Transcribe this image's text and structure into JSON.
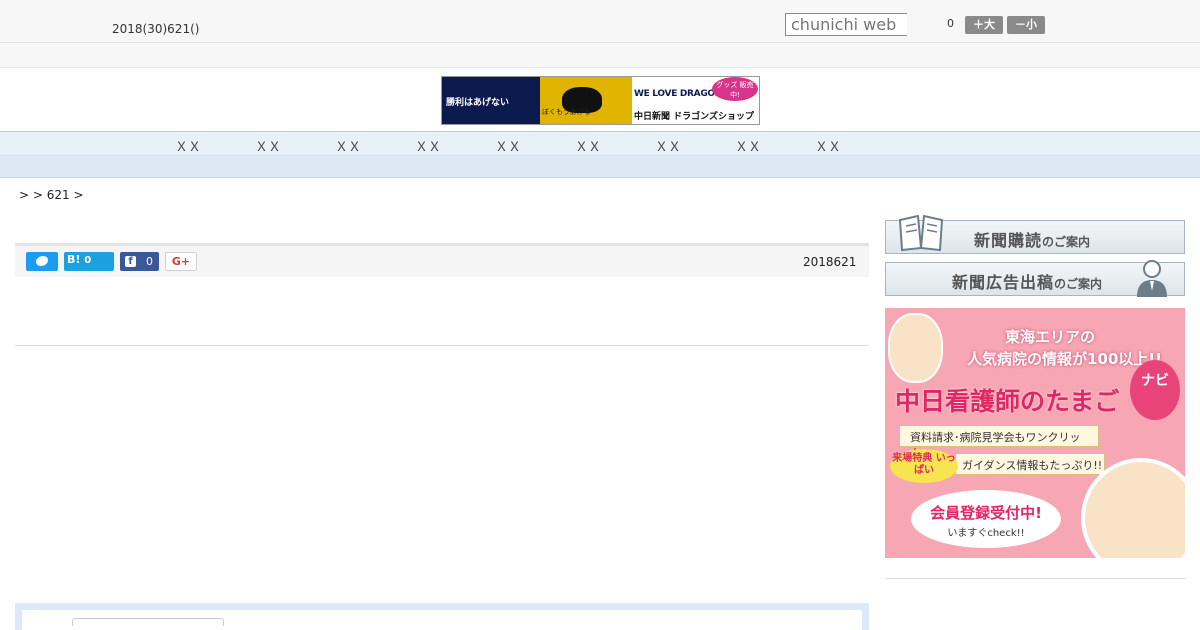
{
  "header": {
    "date_text": "2018(30)621()",
    "search_placeholder": "chunichi web",
    "font_size_value": "0",
    "font_large_label": "＋大",
    "font_small_label": "－小"
  },
  "banner": {
    "left_text": "勝利はあげない",
    "yellow_text": "ぼくもうあげる",
    "right_top_text": "WE LOVE DRAGONS",
    "right_bottom_text": "中日新聞 ドラゴンズショップ",
    "badge_text": "グッズ 販売中!"
  },
  "nav": {
    "items": [
      "ＸＸ",
      "ＸＸ",
      "ＸＸ",
      "ＸＸ",
      "ＸＸ",
      "ＸＸ",
      "ＸＸ",
      "ＸＸ",
      "ＸＸ"
    ]
  },
  "breadcrumb": {
    "text": "> > 621 >"
  },
  "share": {
    "hatena_label": "B!",
    "hatena_count": "0",
    "facebook_glyph": "f",
    "facebook_count": "0",
    "gplus_label": "G+"
  },
  "article": {
    "date": "2018621"
  },
  "sidebar": {
    "subscribe_label": "新聞購読",
    "subscribe_suffix": "のご案内",
    "ad_label": "新聞広告出稿",
    "ad_suffix": "のご案内"
  },
  "nurse_ad": {
    "line1": "東海エリアの",
    "line2": "人気病院の情報が100以上!!",
    "title": "中日看護師のたまご",
    "navi": "ナビ",
    "strip1": "資料請求･病院見学会もワンクリック!!",
    "strip2": "ガイダンス情報もたっぷり!!",
    "badge": "来場特典 いっぱい",
    "cta": "会員登録受付中!",
    "cta2": "いますぐcheck!!"
  }
}
